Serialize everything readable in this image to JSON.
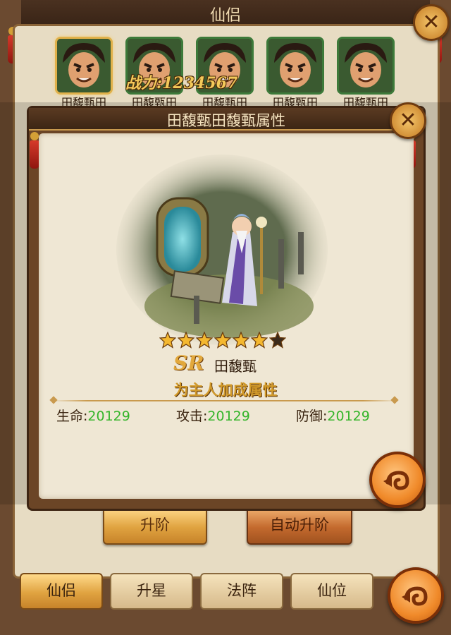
{
  "window": {
    "title": "仙侣"
  },
  "portraits": [
    {
      "name": "田馥甄田",
      "selected": true
    },
    {
      "name": "田馥甄田",
      "selected": false
    },
    {
      "name": "田馥甄田",
      "selected": false
    },
    {
      "name": "田馥甄田",
      "selected": false
    },
    {
      "name": "田馥甄田",
      "selected": false
    }
  ],
  "dialog": {
    "title": "田馥甄田馥甄属性",
    "close_icon": "close-icon",
    "power_label": "战力:1234567",
    "stars": {
      "filled": 6,
      "total": 7
    },
    "rarity": "SR",
    "character_name": "田馥甄",
    "bonus_title": "为主人加成属性",
    "stats": [
      {
        "label": "生命:",
        "value": "20129"
      },
      {
        "label": "攻击:",
        "value": "20129"
      },
      {
        "label": "防御:",
        "value": "20129"
      }
    ],
    "back_icon": "back-arrow-icon"
  },
  "actions": {
    "upgrade": "升阶",
    "auto_upgrade": "自动升阶"
  },
  "tabs": [
    {
      "label": "仙侣",
      "active": true
    },
    {
      "label": "升星",
      "active": false
    },
    {
      "label": "法阵",
      "active": false
    },
    {
      "label": "仙位",
      "active": false
    }
  ],
  "colors": {
    "gold": "#e0a340",
    "stat_green": "#34b52a",
    "frame_brown": "#6b4526",
    "paper": "#efe7d4"
  }
}
